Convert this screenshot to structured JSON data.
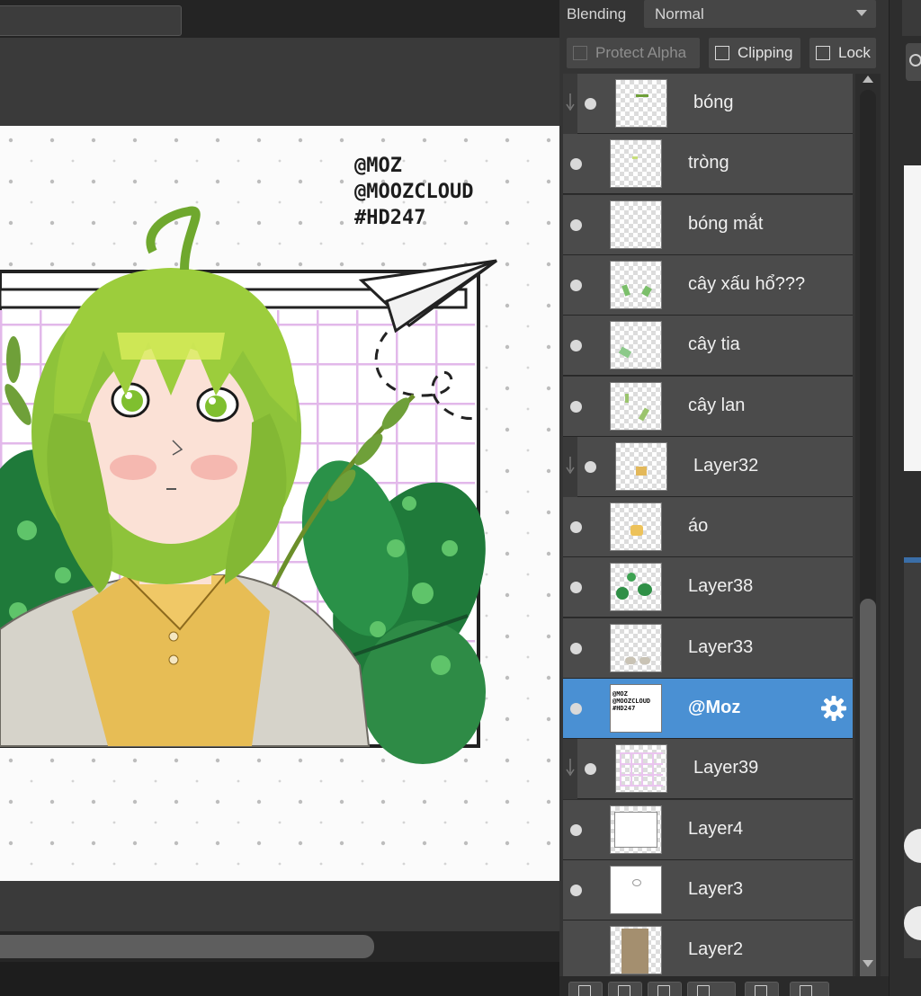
{
  "layer_panel": {
    "blending_label": "Blending",
    "blending_value": "Normal",
    "protect_alpha_label": "Protect Alpha",
    "clipping_label": "Clipping",
    "lock_label": "Lock",
    "layers": [
      {
        "name": "bóng",
        "clipped": true,
        "visible": true,
        "selected": false
      },
      {
        "name": "tròng",
        "clipped": false,
        "visible": true,
        "selected": false
      },
      {
        "name": "bóng mắt",
        "clipped": false,
        "visible": true,
        "selected": false
      },
      {
        "name": "cây xấu hổ???",
        "clipped": false,
        "visible": true,
        "selected": false
      },
      {
        "name": "cây tia",
        "clipped": false,
        "visible": true,
        "selected": false
      },
      {
        "name": "cây lan",
        "clipped": false,
        "visible": true,
        "selected": false
      },
      {
        "name": "Layer32",
        "clipped": true,
        "visible": true,
        "selected": false
      },
      {
        "name": "áo",
        "clipped": false,
        "visible": true,
        "selected": false
      },
      {
        "name": "Layer38",
        "clipped": false,
        "visible": true,
        "selected": false
      },
      {
        "name": "Layer33",
        "clipped": false,
        "visible": true,
        "selected": false
      },
      {
        "name": "@Moz",
        "clipped": false,
        "visible": true,
        "selected": true
      },
      {
        "name": "Layer39",
        "clipped": true,
        "visible": true,
        "selected": false
      },
      {
        "name": "Layer4",
        "clipped": false,
        "visible": true,
        "selected": false
      },
      {
        "name": "Layer3",
        "clipped": false,
        "visible": true,
        "selected": false
      },
      {
        "name": "Layer2",
        "clipped": false,
        "visible": false,
        "selected": false
      }
    ]
  },
  "artwork": {
    "signature_lines": [
      "@MOZ",
      "@MOOZCLOUD",
      "#HD247"
    ]
  },
  "colors": {
    "selected_layer": "#4a90d3",
    "panel_bg": "#343434",
    "layer_bg": "#4b4b4b"
  }
}
